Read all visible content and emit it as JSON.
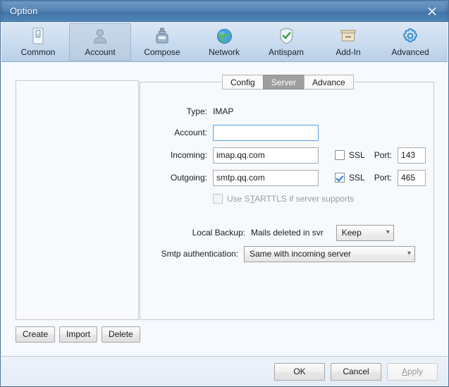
{
  "window": {
    "title": "Option",
    "close_icon": "close-icon"
  },
  "toolbar": {
    "items": [
      {
        "label": "Common",
        "icon": "common-icon",
        "selected": false
      },
      {
        "label": "Account",
        "icon": "account-icon",
        "selected": true
      },
      {
        "label": "Compose",
        "icon": "compose-icon",
        "selected": false
      },
      {
        "label": "Network",
        "icon": "network-icon",
        "selected": false
      },
      {
        "label": "Antispam",
        "icon": "antispam-icon",
        "selected": false
      },
      {
        "label": "Add-In",
        "icon": "addin-icon",
        "selected": false
      },
      {
        "label": "Advanced",
        "icon": "advanced-icon",
        "selected": false
      }
    ]
  },
  "left_panel": {
    "list_items": [],
    "buttons": [
      {
        "label": "Create"
      },
      {
        "label": "Import"
      },
      {
        "label": "Delete"
      }
    ]
  },
  "tabs": [
    {
      "label": "Config",
      "active": false
    },
    {
      "label": "Server",
      "active": true
    },
    {
      "label": "Advance",
      "active": false
    }
  ],
  "server_form": {
    "type_label": "Type:",
    "type_value": "IMAP",
    "account_label": "Account:",
    "account_value": "",
    "account_placeholder": "",
    "incoming_label": "Incoming:",
    "incoming_value": "imap.qq.com",
    "incoming_ssl_label": "SSL",
    "incoming_ssl_checked": false,
    "incoming_port_label": "Port:",
    "incoming_port_value": "143",
    "outgoing_label": "Outgoing:",
    "outgoing_value": "smtp.qq.com",
    "outgoing_ssl_label": "SSL",
    "outgoing_ssl_checked": true,
    "outgoing_port_label": "Port:",
    "outgoing_port_value": "465",
    "starttls_label_pre": "Use S",
    "starttls_label_accel": "T",
    "starttls_label_post": "ARTTLS if server supports",
    "starttls_checked": false,
    "starttls_disabled": true,
    "local_backup_label": "Local Backup:",
    "local_backup_text": "Mails deleted in svr",
    "local_backup_value": "Keep",
    "smtp_auth_label": "Smtp authentication:",
    "smtp_auth_value": "Same with incoming server"
  },
  "footer": {
    "ok_label": "OK",
    "cancel_label": "Cancel",
    "apply_label_accel": "A",
    "apply_label_post": "pply",
    "apply_disabled": true
  },
  "colors": {
    "title_bar": "#4a7cae",
    "toolbar_top": "#dbe7f4",
    "accent_focus": "#5aa0e0",
    "check_blue": "#1c7fd6",
    "active_tab_bg": "#9e9e9e"
  }
}
